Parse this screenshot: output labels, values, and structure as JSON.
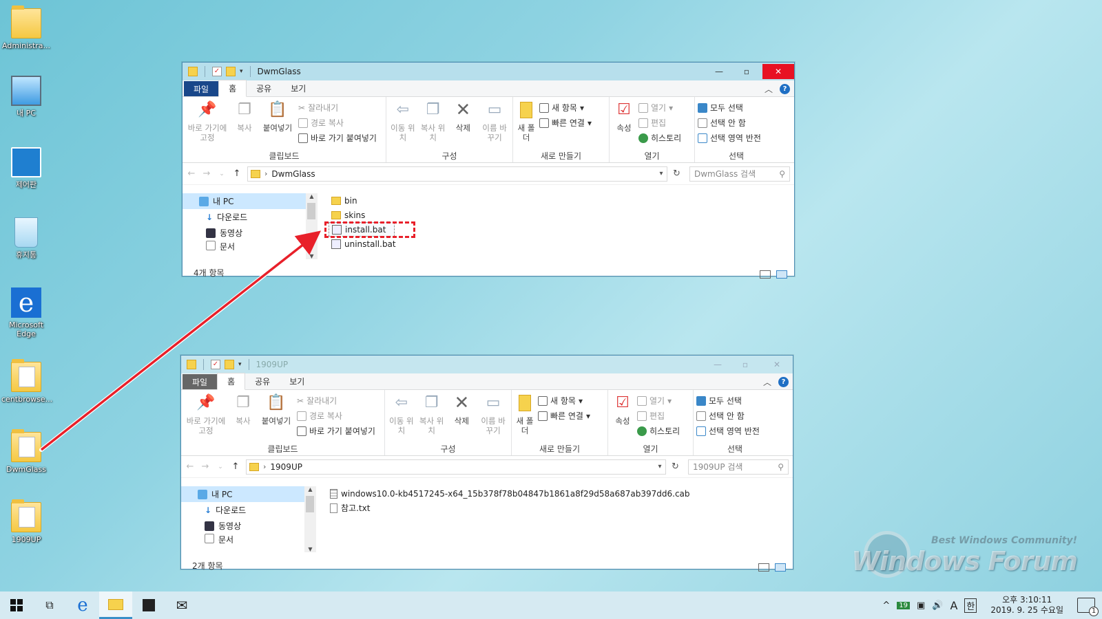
{
  "desktop": {
    "icons": [
      {
        "label": "Administra...",
        "icon": "user-folder-icon"
      },
      {
        "label": "내 PC",
        "icon": "computer-icon"
      },
      {
        "label": "제어판",
        "icon": "control-panel-icon"
      },
      {
        "label": "휴지통",
        "icon": "recycle-bin-icon"
      },
      {
        "label": "Microsoft Edge",
        "icon": "edge-icon"
      },
      {
        "label": "centbrowse...",
        "icon": "folder-icon"
      },
      {
        "label": "DwmGlass",
        "icon": "folder-icon"
      },
      {
        "label": "1909UP",
        "icon": "folder-icon"
      }
    ]
  },
  "windows": [
    {
      "title": "DwmGlass",
      "active": true,
      "tabs": [
        "파일",
        "홈",
        "공유",
        "보기"
      ],
      "ribbon": {
        "clipboard": {
          "pin": "바로 가기에 고정",
          "copy": "복사",
          "paste": "붙여넣기",
          "cut": "잘라내기",
          "copy_path": "경로 복사",
          "paste_shortcut": "바로 가기 붙여넣기",
          "label": "클립보드"
        },
        "organize": {
          "move": "이동 위치",
          "copy_to": "복사 위치",
          "delete": "삭제",
          "rename": "이름 바꾸기",
          "label": "구성"
        },
        "new": {
          "new_folder": "새 폴더",
          "new_item": "새 항목",
          "easy_access": "빠른 연결",
          "label": "새로 만들기"
        },
        "open": {
          "properties": "속성",
          "open": "열기",
          "edit": "편집",
          "history": "히스토리",
          "label": "열기"
        },
        "select": {
          "select_all": "모두 선택",
          "select_none": "선택 안 함",
          "invert": "선택 영역 반전",
          "label": "선택"
        }
      },
      "address": "DwmGlass",
      "search_placeholder": "DwmGlass 검색",
      "nav": [
        "내 PC",
        "다운로드",
        "동영상",
        "문서"
      ],
      "files": [
        "bin",
        "skins",
        "install.bat",
        "uninstall.bat"
      ],
      "status": "4개 항목"
    },
    {
      "title": "1909UP",
      "active": false,
      "tabs": [
        "파일",
        "홈",
        "공유",
        "보기"
      ],
      "ribbon": {
        "clipboard": {
          "pin": "바로 가기에 고정",
          "copy": "복사",
          "paste": "붙여넣기",
          "cut": "잘라내기",
          "copy_path": "경로 복사",
          "paste_shortcut": "바로 가기 붙여넣기",
          "label": "클립보드"
        },
        "organize": {
          "move": "이동 위치",
          "copy_to": "복사 위치",
          "delete": "삭제",
          "rename": "이름 바꾸기",
          "label": "구성"
        },
        "new": {
          "new_folder": "새 폴더",
          "new_item": "새 항목",
          "easy_access": "빠른 연결",
          "label": "새로 만들기"
        },
        "open": {
          "properties": "속성",
          "open": "열기",
          "edit": "편집",
          "history": "히스토리",
          "label": "열기"
        },
        "select": {
          "select_all": "모두 선택",
          "select_none": "선택 안 함",
          "invert": "선택 영역 반전",
          "label": "선택"
        }
      },
      "address": "1909UP",
      "search_placeholder": "1909UP 검색",
      "nav": [
        "내 PC",
        "다운로드",
        "동영상",
        "문서"
      ],
      "files": [
        "windows10.0-kb4517245-x64_15b378f78b04847b1861a8f29d58a687ab397dd6.cab",
        "참고.txt"
      ],
      "status": "2개 항목"
    }
  ],
  "watermark": {
    "tagline": "Best Windows Community!",
    "brand": "Windows Forum"
  },
  "taskbar": {
    "tray_badge": "19",
    "ime_mode": "A",
    "ime_lang": "한",
    "time": "오후 3:10:11",
    "date": "2019. 9. 25  수요일",
    "notification_count": "1"
  },
  "colors": {
    "highlight": "#e8202a",
    "file_tab": "#19478a",
    "close": "#e81123"
  }
}
